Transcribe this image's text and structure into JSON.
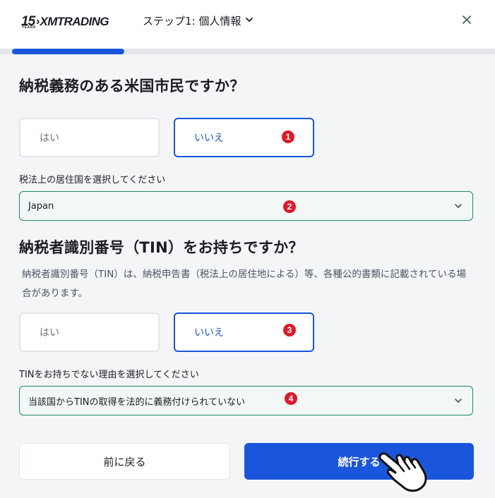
{
  "header": {
    "logo_number": "15",
    "logo_years": "YEARS",
    "logo_text": "XMTRADING",
    "step_label": "ステップ1: 個人情報",
    "close_icon": "close-icon",
    "chevron_icon": "chevron-down-icon"
  },
  "progress": {
    "fraction": 0.227,
    "color": "#1a56db"
  },
  "question1": {
    "title": "納税義務のある米国市民ですか？",
    "yes": "はい",
    "no": "いいえ",
    "selected": "いいえ"
  },
  "residence": {
    "label": "税法上の居住国を選択してください",
    "value": "Japan"
  },
  "question2": {
    "title": "納税者識別番号（TIN）をお持ちですか？",
    "description": "納税者識別番号（TIN）は、納税申告書（税法上の居住地による）等、各種公的書類に記載されている場合があります。",
    "yes": "はい",
    "no": "いいえ",
    "selected": "いいえ"
  },
  "tin_reason": {
    "label": "TINをお持ちでない理由を選択してください",
    "value": "当該国からTINの取得を法的に義務付けられていない"
  },
  "badges": [
    "1",
    "2",
    "3",
    "4"
  ],
  "footer": {
    "back": "前に戻る",
    "continue": "続行する"
  },
  "colors": {
    "accent": "#1a56db",
    "badge": "#e0192a",
    "select_border": "#1f8a64",
    "select_bg": "#f1f8f5"
  },
  "cursor_icon": "hand-pointer-icon"
}
